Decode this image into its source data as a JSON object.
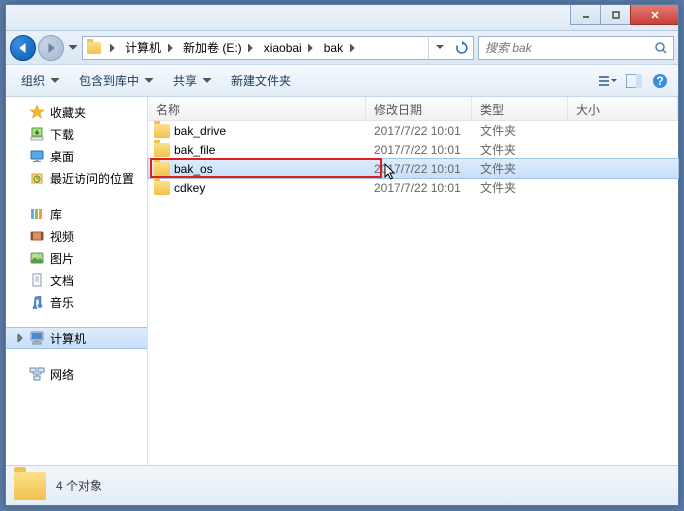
{
  "window": {
    "min_tip": "Minimize",
    "max_tip": "Maximize",
    "close_tip": "Close"
  },
  "nav": {
    "back_tip": "Back",
    "fwd_tip": "Forward"
  },
  "breadcrumbs": [
    "计算机",
    "新加卷 (E:)",
    "xiaobai",
    "bak"
  ],
  "search": {
    "placeholder": "搜索 bak"
  },
  "toolbar": {
    "organize": "组织",
    "include": "包含到库中",
    "share": "共享",
    "newfolder": "新建文件夹"
  },
  "columns": {
    "name": "名称",
    "date": "修改日期",
    "type": "类型",
    "size": "大小"
  },
  "rows": [
    {
      "name": "bak_drive",
      "date": "2017/7/22 10:01",
      "type": "文件夹",
      "selected": false
    },
    {
      "name": "bak_file",
      "date": "2017/7/22 10:01",
      "type": "文件夹",
      "selected": false
    },
    {
      "name": "bak_os",
      "date": "2017/7/22 10:01",
      "type": "文件夹",
      "selected": true,
      "highlighted": true
    },
    {
      "name": "cdkey",
      "date": "2017/7/22 10:01",
      "type": "文件夹",
      "selected": false
    }
  ],
  "sidebar": {
    "favorites": {
      "label": "收藏夹",
      "items": [
        "下载",
        "桌面",
        "最近访问的位置"
      ]
    },
    "libraries": {
      "label": "库",
      "items": [
        "视频",
        "图片",
        "文档",
        "音乐"
      ]
    },
    "computer": {
      "label": "计算机"
    },
    "network": {
      "label": "网络"
    }
  },
  "status": {
    "text": "4 个对象"
  }
}
